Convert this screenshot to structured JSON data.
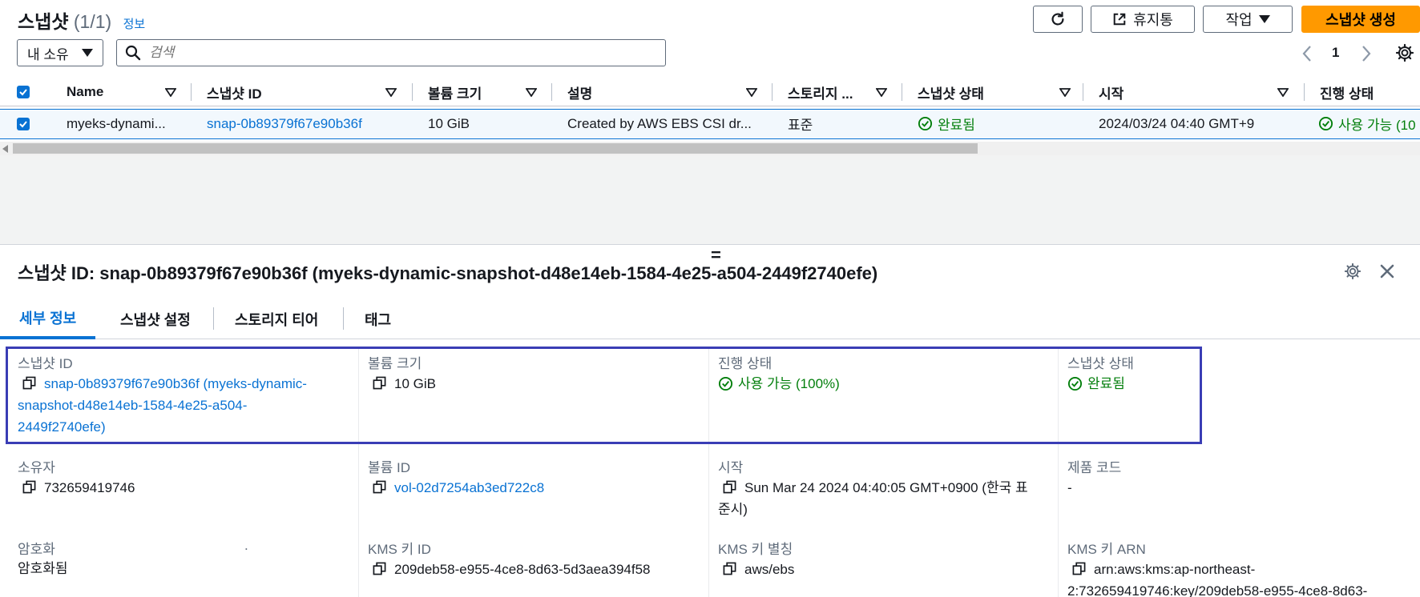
{
  "header": {
    "title": "스냅샷",
    "count": "(1/1)",
    "info_link": "정보",
    "buttons": {
      "recycle": "휴지통",
      "actions": "작업",
      "create": "스냅샷 생성"
    }
  },
  "filter": {
    "owner_select": "내 소유",
    "search_placeholder": "검색"
  },
  "pagination": {
    "page": "1"
  },
  "table": {
    "columns": [
      "Name",
      "스냅샷 ID",
      "볼륨 크기",
      "설명",
      "스토리지 ...",
      "스냅샷 상태",
      "시작",
      "진행 상태"
    ],
    "row": {
      "name": "myeks-dynami...",
      "snapshot_id": "snap-0b89379f67e90b36f",
      "volume_size": "10 GiB",
      "description": "Created by AWS EBS CSI dr...",
      "storage": "표준",
      "status": "완료됨",
      "started": "2024/03/24 04:40 GMT+9",
      "progress": "사용 가능 (10"
    }
  },
  "splitter": "=",
  "detail": {
    "title": "스냅샷 ID: snap-0b89379f67e90b36f (myeks-dynamic-snapshot-d48e14eb-1584-4e25-a504-2449f2740efe)",
    "tabs": [
      "세부 정보",
      "스냅샷 설정",
      "스토리지 티어",
      "태그"
    ],
    "fields": {
      "snapshot_id_label": "스냅샷 ID",
      "snapshot_id_line1": "snap-0b89379f67e90b36f (myeks-dynamic-",
      "snapshot_id_line2": "snapshot-d48e14eb-1584-4e25-a504-",
      "snapshot_id_line3": "2449f2740efe)",
      "volume_size_label": "볼륨 크기",
      "volume_size": "10 GiB",
      "progress_label": "진행 상태",
      "progress": "사용 가능 (100%)",
      "status_label": "스냅샷 상태",
      "status": "완료됨",
      "owner_label": "소유자",
      "owner": "732659419746",
      "volume_id_label": "볼륨 ID",
      "volume_id": "vol-02d7254ab3ed722c8",
      "started_label": "시작",
      "started_line1": "Sun Mar 24 2024 04:40:05 GMT+0900 (한국 표",
      "started_line2": "준시)",
      "product_code_label": "제품 코드",
      "product_code": "-",
      "encryption_label": "암호화",
      "encryption_dot": ".",
      "encryption": "암호화됨",
      "kms_key_id_label": "KMS 키 ID",
      "kms_key_id": "209deb58-e955-4ce8-8d63-5d3aea394f58",
      "kms_alias_label": "KMS 키 별칭",
      "kms_alias": "aws/ebs",
      "kms_arn_label": "KMS 키 ARN",
      "kms_arn_line1": "arn:aws:kms:ap-northeast-",
      "kms_arn_line2": "2:732659419746:key/209deb58-e955-4ce8-8d63-"
    }
  },
  "colors": {
    "primary": "#ff9900",
    "link": "#0972d3",
    "success": "#037f0c",
    "highlight": "#3a3db5"
  }
}
